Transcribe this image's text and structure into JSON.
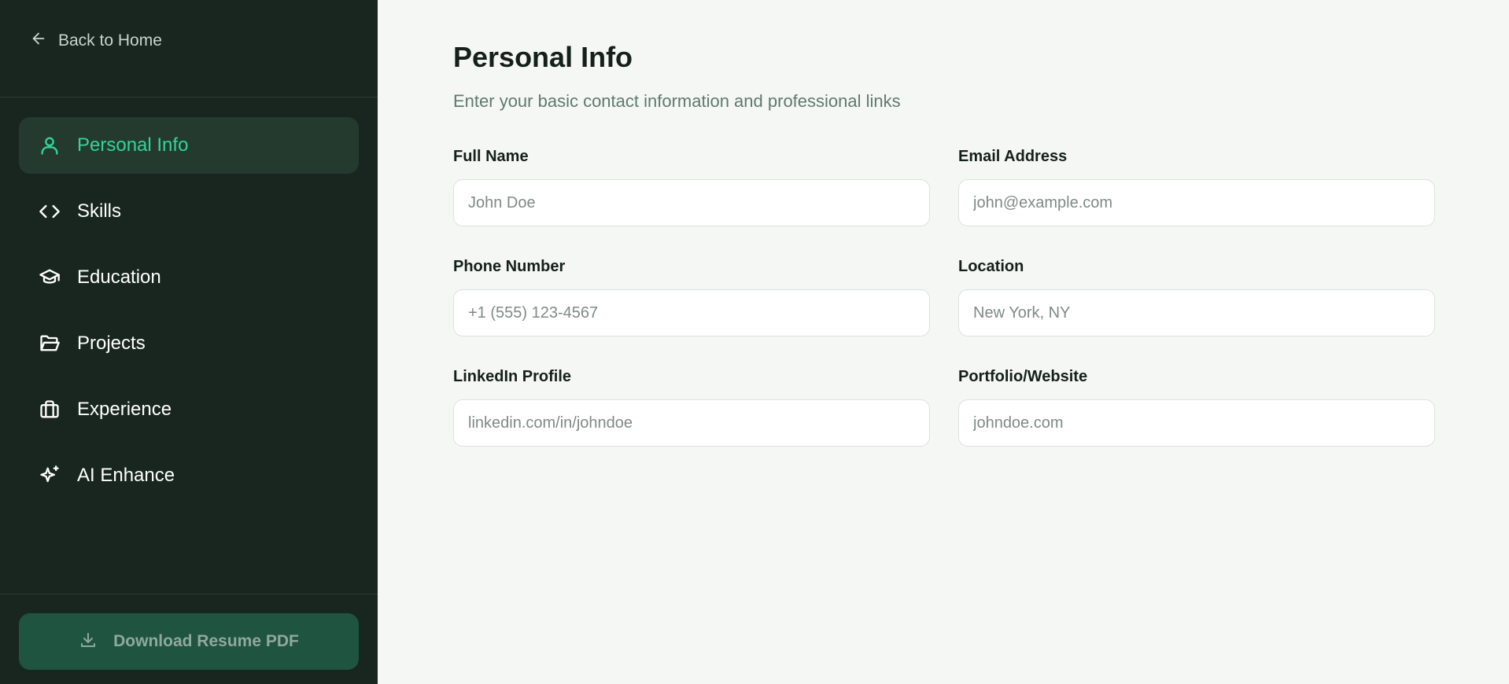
{
  "sidebar": {
    "back_label": "Back to Home",
    "items": [
      {
        "label": "Personal Info",
        "icon": "user-icon",
        "active": true
      },
      {
        "label": "Skills",
        "icon": "code-icon",
        "active": false
      },
      {
        "label": "Education",
        "icon": "graduation-cap-icon",
        "active": false
      },
      {
        "label": "Projects",
        "icon": "folder-open-icon",
        "active": false
      },
      {
        "label": "Experience",
        "icon": "briefcase-icon",
        "active": false
      },
      {
        "label": "AI Enhance",
        "icon": "sparkles-icon",
        "active": false
      }
    ],
    "download_label": "Download Resume PDF"
  },
  "main": {
    "title": "Personal Info",
    "subtitle": "Enter your basic contact information and professional links",
    "fields": [
      {
        "label": "Full Name",
        "placeholder": "John Doe",
        "value": ""
      },
      {
        "label": "Email Address",
        "placeholder": "john@example.com",
        "value": ""
      },
      {
        "label": "Phone Number",
        "placeholder": "+1 (555) 123-4567",
        "value": ""
      },
      {
        "label": "Location",
        "placeholder": "New York, NY",
        "value": ""
      },
      {
        "label": "LinkedIn Profile",
        "placeholder": "linkedin.com/in/johndoe",
        "value": ""
      },
      {
        "label": "Portfolio/Website",
        "placeholder": "johndoe.com",
        "value": ""
      }
    ]
  },
  "colors": {
    "sidebar_bg": "#18261f",
    "active_item_bg": "#243a2f",
    "accent": "#34d399",
    "download_bg": "#1e5440",
    "main_bg": "#f5f7f5"
  }
}
